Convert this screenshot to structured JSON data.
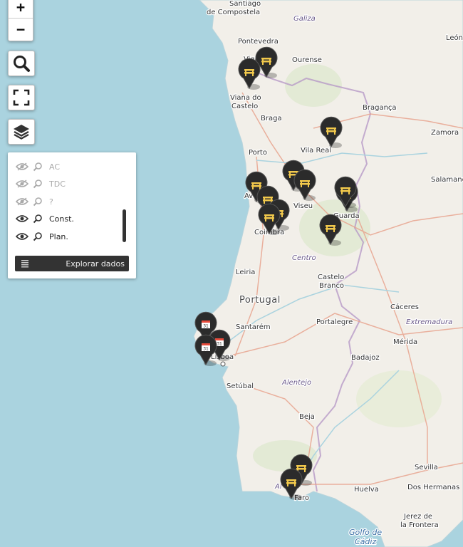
{
  "map": {
    "places": {
      "santiago": "Santiago",
      "compostela": "de Compostela",
      "galiza": "Galiza",
      "pontevedra": "Pontevedra",
      "ourense": "Ourense",
      "vigo": "Vigo",
      "viana1": "Viana do",
      "viana2": "Castelo",
      "braga": "Braga",
      "braganca": "Bragança",
      "zamora": "Zamora",
      "porto": "Porto",
      "vila_real": "Vila Real",
      "salamanca": "Salamanc",
      "aveiro": "Aveiro",
      "viseu": "Viseu",
      "guarda": "Guarda",
      "coimbra": "Coimbra",
      "centro": "Centro",
      "castelo1": "Castelo",
      "castelo2": "Branco",
      "leiria": "Leiria",
      "portugal": "Portugal",
      "caceres": "Cáceres",
      "santarem": "Santarém",
      "portalegre": "Portalegre",
      "extremadura": "Extremadura",
      "merida": "Mérida",
      "lisboa": "Lisboa",
      "badajoz": "Badajoz",
      "setubal": "Setúbal",
      "alentejo": "Alentejo",
      "beja": "Beja",
      "sevilla": "Sevilla",
      "dos_hermanas": "Dos Hermanas",
      "huelva": "Huelva",
      "faro": "Faro",
      "algarve": "Al",
      "jerez1": "Jerez de",
      "jerez2": "la Frontera",
      "golfo1": "Golfo de",
      "golfo2": "Cádiz",
      "leon": "León"
    },
    "markers": {
      "construction": "construction-marker",
      "event": "calendar-marker"
    }
  },
  "controls": {
    "zoom_in": "+",
    "zoom_out": "−"
  },
  "layers": {
    "items": [
      {
        "label": "AC",
        "visible": false
      },
      {
        "label": "TDC",
        "visible": false
      },
      {
        "label": "?",
        "visible": false
      },
      {
        "label": "Const.",
        "visible": true
      },
      {
        "label": "Plan.",
        "visible": true
      }
    ],
    "explore_label": "Explorar dados"
  },
  "colors": {
    "sea": "#aad3df",
    "land": "#f2efe9",
    "marker": "#2b2b2b",
    "construction_icon": "#f2c94c",
    "event_icon": "#e74c3c"
  }
}
